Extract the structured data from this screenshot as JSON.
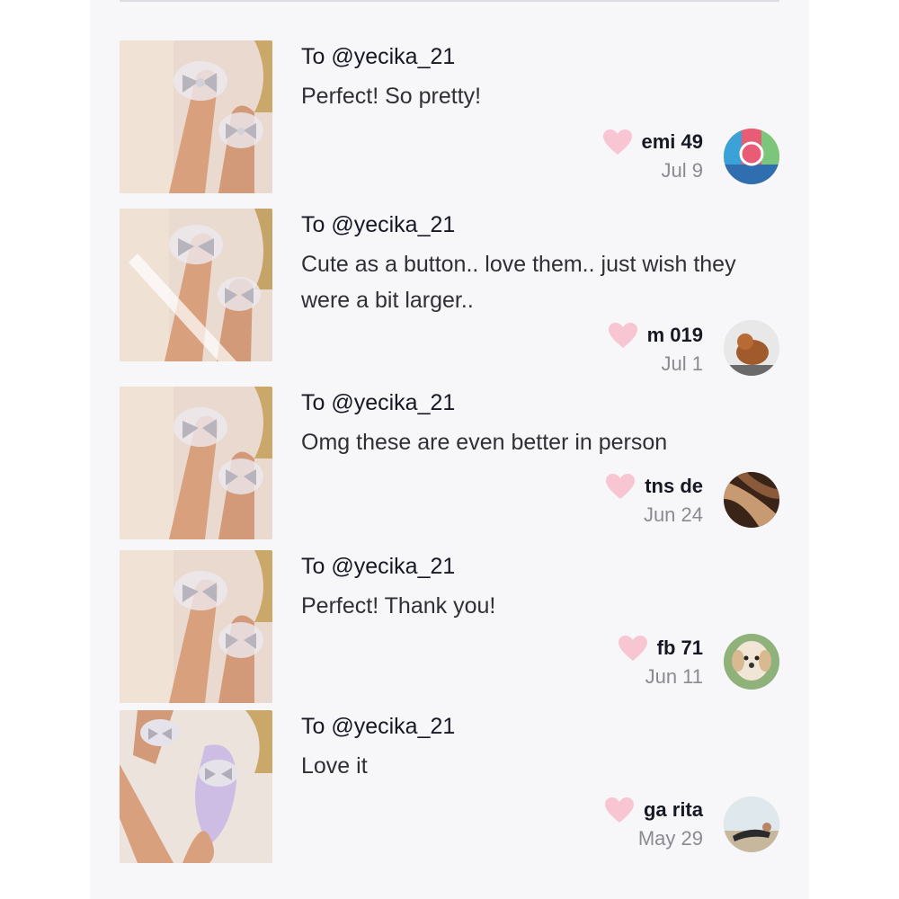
{
  "reviews": [
    {
      "recipient": "To @yecika_21",
      "text": "Perfect! So pretty!",
      "username": "emi 49",
      "date": "Jul 9",
      "avatar_icon": "colorful-building-logo-avatar"
    },
    {
      "recipient": "To @yecika_21",
      "text": "Cute as a button.. love them.. just wish they were a bit larger..",
      "username": "m 019",
      "date": "Jul 1",
      "avatar_icon": "dog-photo-avatar"
    },
    {
      "recipient": "To @yecika_21",
      "text": "Omg these are even better in person",
      "username": "tns de",
      "date": "Jun 24",
      "avatar_icon": "hair-photo-avatar"
    },
    {
      "recipient": "To @yecika_21",
      "text": "Perfect! Thank you!",
      "username": "fb 71",
      "date": "Jun 11",
      "avatar_icon": "puppy-photo-avatar"
    },
    {
      "recipient": "To @yecika_21",
      "text": "Love it",
      "username": "ga rita",
      "date": "May 29",
      "avatar_icon": "beach-photo-avatar"
    }
  ],
  "colors": {
    "heart": "#f8c6d2",
    "panel_bg": "#f7f7f9",
    "date_text": "#8a8b91"
  }
}
